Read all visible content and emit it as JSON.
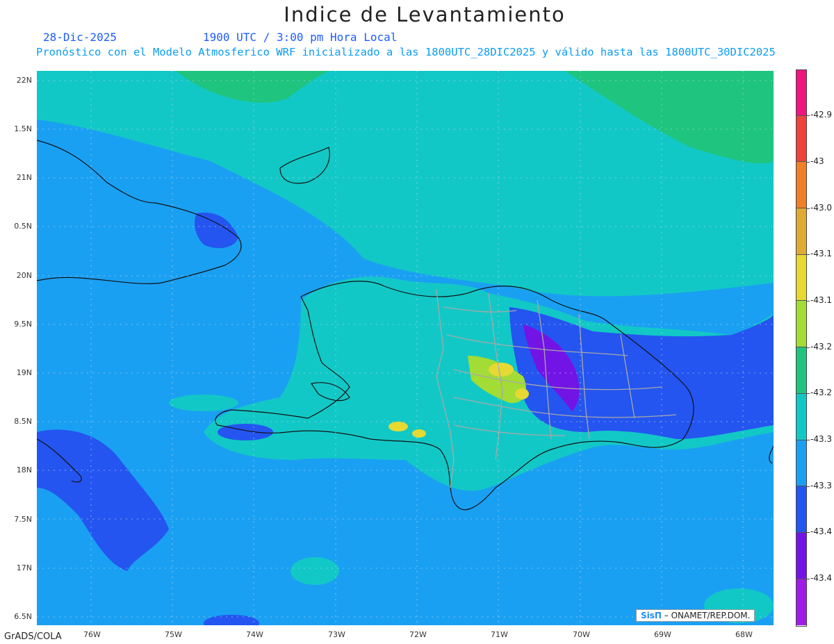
{
  "title": "Indice de Levantamiento",
  "date": "28-Dic-2025",
  "time_line": "1900 UTC / 3:00 pm Hora Local",
  "forecast_line": "Pronóstico con el Modelo Atmosferico WRF inicializado a las 1800UTC_28DIC2025 y válido hasta las  1800UTC_30DIC2025",
  "credit_left": "GrADS/COLA",
  "credit_brand": "SisΠ",
  "credit_org": " – ONAMET/REP.DOM.",
  "lat_labels": [
    "22N",
    "1.5N",
    "21N",
    "0.5N",
    "20N",
    "9.5N",
    "19N",
    "8.5N",
    "18N",
    "7.5N",
    "17N",
    "6.5N"
  ],
  "lon_labels": [
    "76W",
    "75W",
    "74W",
    "73W",
    "72W",
    "71W",
    "70W",
    "69W",
    "68W"
  ],
  "colorbar": {
    "labels": [
      "-42.9",
      "-43",
      "-43.0",
      "-43.1",
      "-43.1",
      "-43.2",
      "-43.2",
      "-43.3",
      "-43.3",
      "-43.4",
      "-43.4"
    ],
    "colors": [
      "#f0147f",
      "#f0413c",
      "#f07f28",
      "#e0ab32",
      "#e6d932",
      "#a2dc34",
      "#1fc47e",
      "#12c8c6",
      "#1aa0f2",
      "#2455f0",
      "#7314e6",
      "#a01ce6"
    ]
  },
  "field_colors": {
    "ocean_main": "#1aa0f2",
    "north_band": "#12c8c6",
    "top_band": "#1fc47e",
    "dark_blue": "#2455f0",
    "purple": "#7314e6",
    "yellow": "#e6d932",
    "green": "#a2dc34"
  }
}
